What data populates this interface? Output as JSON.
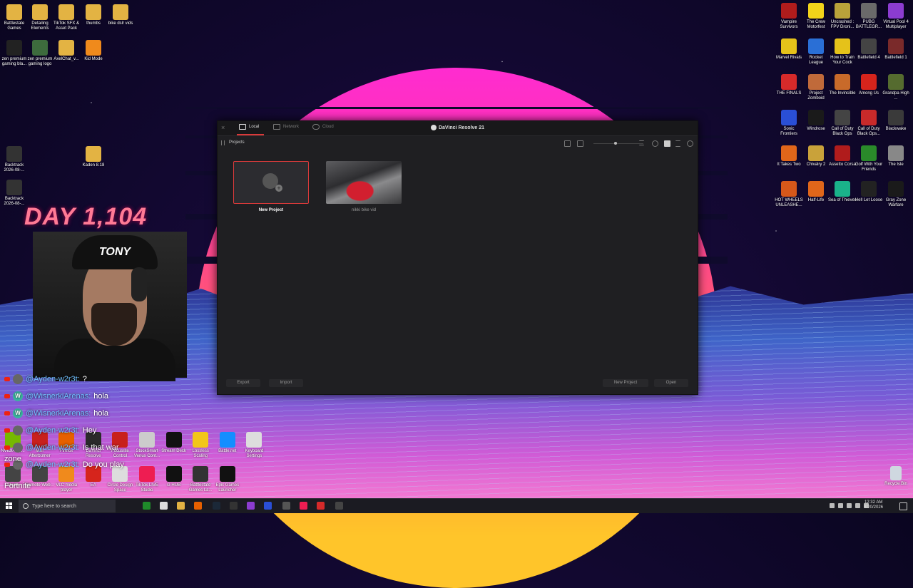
{
  "desktop_left": [
    {
      "id": "battlestate",
      "label": "Battlestate Games",
      "color": "#e3b343"
    },
    {
      "id": "detailing",
      "label": "Detailing Elements",
      "color": "#e3b343"
    },
    {
      "id": "tiktok-sfx",
      "label": "TikTok SFX & Asset Pack",
      "color": "#e3b343"
    },
    {
      "id": "thumbs",
      "label": "thumbs",
      "color": "#e3b343"
    },
    {
      "id": "bike-dslr",
      "label": "bike dslr vids",
      "color": "#e3b343"
    },
    {
      "id": "zen-premium-blk",
      "label": "zen premium gaming bla...",
      "color": "#222222"
    },
    {
      "id": "zen-premium-logo",
      "label": "zen premium gaming logo",
      "color": "#3d6b3d"
    },
    {
      "id": "axelchat",
      "label": "AxelChat_v...",
      "color": "#e3b343"
    },
    {
      "id": "kid-mode",
      "label": "Kid Mode",
      "color": "#f08a1c"
    },
    {
      "id": "backtrack-1",
      "label": "Backtrack 2026-08-...",
      "color": "#333333"
    },
    {
      "id": "kaden",
      "label": "Kaden 8.18",
      "color": "#e3b343"
    },
    {
      "id": "backtrack-2",
      "label": "Backtrack 2026-08-...",
      "color": "#333333"
    }
  ],
  "desktop_right": [
    {
      "id": "vampire",
      "label": "Vampire Survivors",
      "color": "#b01c1c"
    },
    {
      "id": "crew",
      "label": "The Crew Motorfest",
      "color": "#f2d31a"
    },
    {
      "id": "uncrashed",
      "label": "Uncrashed : FPV Droni...",
      "color": "#b9a23a"
    },
    {
      "id": "pubg",
      "label": "PUBG BATTLEGR...",
      "color": "#6a6a6a"
    },
    {
      "id": "pool",
      "label": "Virtual Pool 4 Multiplayer",
      "color": "#8c3cd0"
    },
    {
      "id": "marvel",
      "label": "Marvel Rivals",
      "color": "#e5c21a"
    },
    {
      "id": "rocket",
      "label": "Rocket League",
      "color": "#2a6fd6"
    },
    {
      "id": "train",
      "label": "How to Train Your Cock",
      "color": "#e5c21a"
    },
    {
      "id": "bf4",
      "label": "Battlefield 4",
      "color": "#444444"
    },
    {
      "id": "bf1",
      "label": "Battlefield 1",
      "color": "#7a2a2a"
    },
    {
      "id": "finals",
      "label": "THE FINALS",
      "color": "#d62a2a"
    },
    {
      "id": "zomboid",
      "label": "Project Zomboid",
      "color": "#c06a3a"
    },
    {
      "id": "invincible",
      "label": "The Invincible",
      "color": "#c86a2a"
    },
    {
      "id": "amongus",
      "label": "Among Us",
      "color": "#d6241c"
    },
    {
      "id": "grandpa",
      "label": "Grandpa High ...",
      "color": "#556b2f"
    },
    {
      "id": "sonic",
      "label": "Sonic Frontiers",
      "color": "#2a4fd6"
    },
    {
      "id": "windrose",
      "label": "Windrose",
      "color": "#1a1a1a"
    },
    {
      "id": "cod-bo",
      "label": "Call of Duty Black Ops",
      "color": "#444444"
    },
    {
      "id": "cod-bo2",
      "label": "Call of Duty Black Ops...",
      "color": "#c82a2a"
    },
    {
      "id": "blackwake",
      "label": "Blackwake",
      "color": "#3a3a3a"
    },
    {
      "id": "ittakestwo",
      "label": "It Takes Two",
      "color": "#e0661a"
    },
    {
      "id": "chivalry",
      "label": "Chivalry 2",
      "color": "#c9a23a"
    },
    {
      "id": "assetto",
      "label": "Assetto Corsa",
      "color": "#b01c1c"
    },
    {
      "id": "golf",
      "label": "Golf With Your Friends",
      "color": "#2a8a2a"
    },
    {
      "id": "isle",
      "label": "The Isle",
      "color": "#888888"
    },
    {
      "id": "hotwheels",
      "label": "HOT WHEELS UNLEASHE...",
      "color": "#d6581a"
    },
    {
      "id": "halflife",
      "label": "Half-Life",
      "color": "#e0661a"
    },
    {
      "id": "seaofthieves",
      "label": "Sea of Thieves",
      "color": "#1ab28a"
    },
    {
      "id": "helllet",
      "label": "Hell Let Loose",
      "color": "#222222"
    },
    {
      "id": "grayzone",
      "label": "Gray Zone Warfare",
      "color": "#1a1a1a"
    }
  ],
  "desktop_bottom": [
    {
      "id": "nvidia",
      "label": "NVIDIA Ap...",
      "color": "#76b900"
    },
    {
      "id": "msi",
      "label": "MSI Afterburner",
      "color": "#c8201c"
    },
    {
      "id": "firefox",
      "label": "Firefox",
      "color": "#e66000"
    },
    {
      "id": "davinci",
      "label": "DaVinci Resolve",
      "color": "#2a2a2a"
    },
    {
      "id": "focusrite",
      "label": "Focusrite Control",
      "color": "#c8201c"
    },
    {
      "id": "stock",
      "label": "StockSmart Venus Cont...",
      "color": "#cccccc"
    },
    {
      "id": "streamdeck",
      "label": "Stream Deck",
      "color": "#111111"
    },
    {
      "id": "lossless",
      "label": "Lossless Scaling",
      "color": "#f2c61a"
    },
    {
      "id": "battlenet",
      "label": "Battle.net",
      "color": "#148eff"
    },
    {
      "id": "keyboard",
      "label": "Keyboard Settings",
      "color": "#dddddd"
    },
    {
      "id": "studio",
      "label": "Studio",
      "color": "#444444"
    },
    {
      "id": "remote",
      "label": "Remote Web...",
      "color": "#444444"
    },
    {
      "id": "vlc",
      "label": "VLC media player",
      "color": "#f08a1c"
    },
    {
      "id": "ea",
      "label": "EA",
      "color": "#d6241c"
    },
    {
      "id": "circle",
      "label": "Circle Design Space",
      "color": "#dddddd"
    },
    {
      "id": "tiktoklive",
      "label": "TikTok LIVE Studio",
      "color": "#ee1d52"
    },
    {
      "id": "gghub",
      "label": "G HUB",
      "color": "#111111"
    },
    {
      "id": "battlestate-launcher",
      "label": "Battlestate Games La...",
      "color": "#333333"
    },
    {
      "id": "epic",
      "label": "Epic Games Launcher",
      "color": "#111111"
    }
  ],
  "recycle_bin": "Recycle Bin",
  "resolve": {
    "close": "×",
    "tabs": [
      "Local",
      "Network",
      "Cloud"
    ],
    "app_title": "DaVinci Resolve 21",
    "projects_label": "Projects",
    "new_project_tile": "New Project",
    "project_tile": "nikki bike vid",
    "buttons": {
      "export": "Export",
      "import": "Import",
      "new_project": "New Project",
      "open": "Open"
    },
    "accent": "#d93a3a"
  },
  "overlay": {
    "day_counter": "DAY 1,104",
    "hat_text": "TONY"
  },
  "chat": [
    {
      "user": "@Ayden-w2r3t:",
      "msg": "?",
      "avatar": "",
      "partial": true
    },
    {
      "user": "@WisnerkiArenas:",
      "msg": "hola",
      "avatar": "W"
    },
    {
      "user": "@WisnerkiArenas:",
      "msg": "hola",
      "avatar": "W"
    },
    {
      "user": "@Ayden-w2r3t:",
      "msg": "Hey",
      "avatar": ""
    },
    {
      "user": "@Ayden-w2r3t:",
      "msg": "Is that war",
      "avatar": ""
    },
    {
      "user": "@Ayden-w2r3t:",
      "msg": "Do you play",
      "avatar": ""
    }
  ],
  "chat_side_labels": [
    "zone",
    "Fortnite"
  ],
  "taskbar": {
    "search_placeholder": "Type here to search",
    "time": "12:32 AM",
    "date": "8/20/2026"
  }
}
